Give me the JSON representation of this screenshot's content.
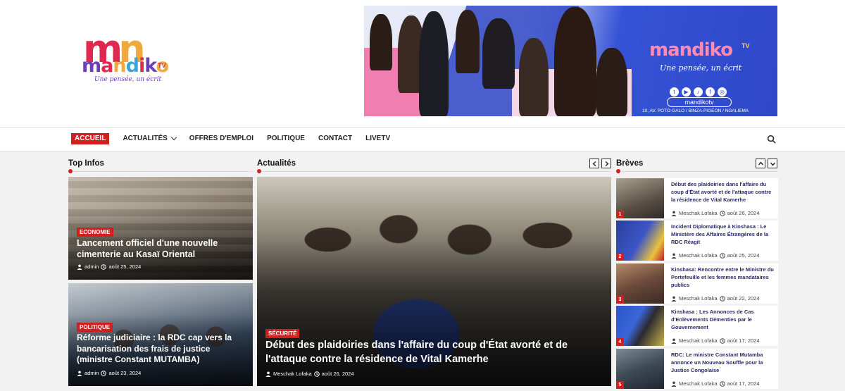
{
  "header": {
    "logo_word": [
      "m",
      "a",
      "n",
      "d",
      "i",
      "k",
      "o"
    ],
    "logo_tv": "TV",
    "logo_slogan": "Une pensée, un écrit",
    "banner": {
      "logo": "mandiko",
      "tv": "TV",
      "slogan": "Une pensée, un écrit",
      "handle": "mandikotv",
      "address": "10, AV. POTO-GALO / BINZA-PIGEON / NGALIEMA"
    }
  },
  "nav": {
    "items": [
      {
        "label": "ACCUEIL"
      },
      {
        "label": "ACTUALITÉS"
      },
      {
        "label": "OFFRES D'EMPLOI"
      },
      {
        "label": "POLITIQUE"
      },
      {
        "label": "CONTACT"
      },
      {
        "label": "LIVETV"
      }
    ]
  },
  "sections": {
    "top_infos": "Top Infos",
    "actualites": "Actualités",
    "breves": "Brèves"
  },
  "top_infos": [
    {
      "category": "ECONOMIE",
      "title": "Lancement officiel d'une nouvelle cimenterie au Kasaï Oriental",
      "author": "admin",
      "date": "août 25, 2024"
    },
    {
      "category": "POLITIQUE",
      "title": "Réforme judiciaire : la RDC cap vers la bancarisation des frais de justice (ministre Constant MUTAMBA)",
      "author": "admin",
      "date": "août 23, 2024"
    }
  ],
  "feature": {
    "category": "SÉCURITÉ",
    "title": "Début des plaidoiries dans l'affaire du coup d'État avorté et de l'attaque contre la résidence de Vital Kamerhe",
    "author": "Meschak Lofaka",
    "date": "août 26, 2024"
  },
  "breves": [
    {
      "num": "1",
      "title": "Début des plaidoiries dans l'affaire du coup d'État avorté et de l'attaque contre la résidence de Vital Kamerhe",
      "author": "Meschak Lofaka",
      "date": "août 26, 2024"
    },
    {
      "num": "2",
      "title": "Incident Diplomatique à Kinshasa : Le Ministère des Affaires Étrangères de la RDC Réagit",
      "author": "Meschak Lofaka",
      "date": "août 25, 2024"
    },
    {
      "num": "3",
      "title": "Kinshasa: Rencontre entre le Ministre du Portefeuille et les femmes mandataires publics",
      "author": "Meschak Lofaka",
      "date": "août 22, 2024"
    },
    {
      "num": "4",
      "title": "Kinshasa : Les Annonces de Cas d'Enlèvements Démenties par le Gouvernement",
      "author": "Meschak Lofaka",
      "date": "août 17, 2024"
    },
    {
      "num": "5",
      "title": "RDC: Le ministre Constant Mutamba annonce un Nouveau Souffle pour la Justice Congolaise",
      "author": "Meschak Lofaka",
      "date": "août 17, 2024"
    }
  ],
  "colors": {
    "accent": "#d01f1f",
    "brand_pink": "#e0294f",
    "brand_purple": "#6c3fb5",
    "brand_orange": "#f2a93b",
    "banner_blue": "#2f47c9"
  },
  "icons": [
    "search-icon",
    "user-icon",
    "clock-icon",
    "chevron-down-icon",
    "chevron-left-icon",
    "chevron-right-icon",
    "chevron-up-icon"
  ]
}
